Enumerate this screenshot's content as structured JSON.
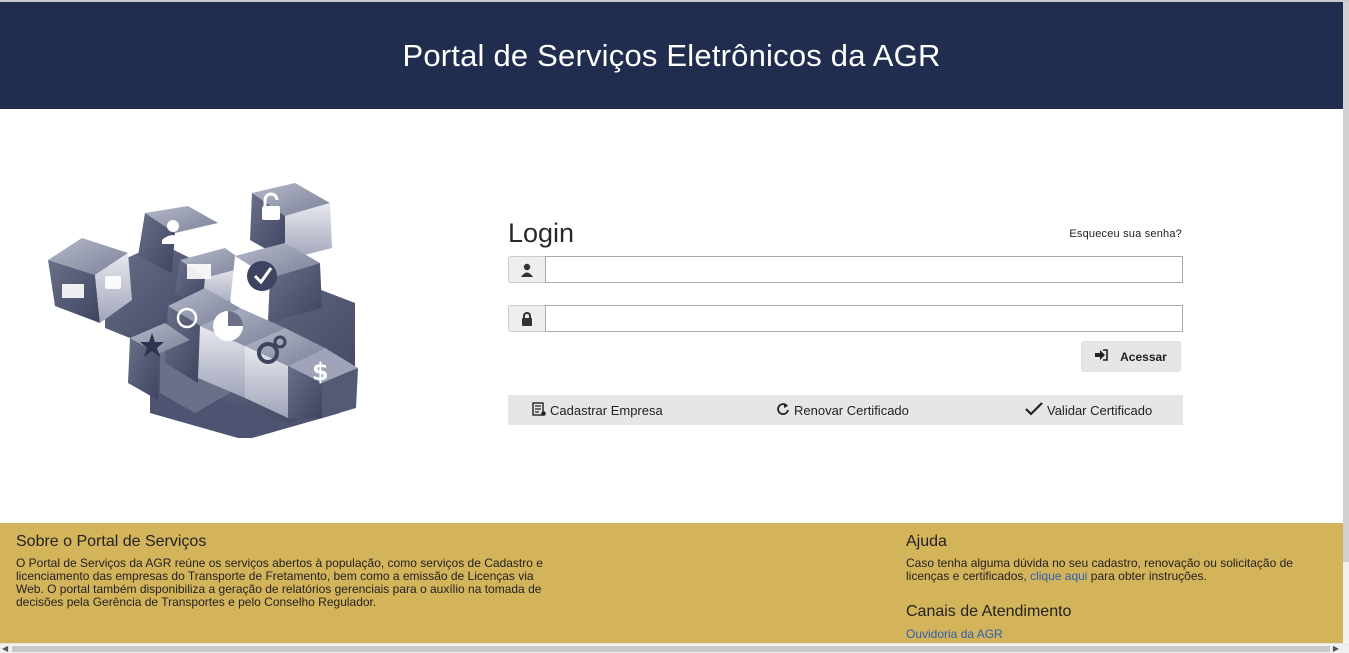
{
  "header": {
    "title": "Portal de Serviços Eletrônicos da AGR"
  },
  "login": {
    "title": "Login",
    "forgot_link": "Esqueceu sua senha?",
    "username_value": "",
    "password_value": "",
    "submit_label": "Acessar"
  },
  "actions": [
    {
      "label": "Cadastrar Empresa",
      "icon": "register-icon"
    },
    {
      "label": "Renovar Certificado",
      "icon": "refresh-icon"
    },
    {
      "label": "Validar Certificado",
      "icon": "check-icon"
    }
  ],
  "footer": {
    "about_title": "Sobre o Portal de Serviços",
    "about_text": "O Portal de Serviços da AGR reúne os serviços abertos à população, como serviços de Cadastro e licenciamento das empresas do Transporte de Fretamento, bem como a emissão de Licenças via Web. O portal também disponibiliza a geração de relatórios gerenciais para o auxílio na tomada de decisões pela Gerência de Transportes e pelo Conselho Regulador.",
    "help_title": "Ajuda",
    "help_text_before": "Caso tenha alguma dúvida no seu cadastro, renovação ou solicitação de licenças e certificados,",
    "help_link": "clique aqui",
    "help_text_after": "para obter instruções.",
    "channels_title": "Canais de Atendimento",
    "channels_link": "Ouvidoria da AGR"
  },
  "colors": {
    "header_bg": "#212d4f",
    "footer_bg": "#d4b45b",
    "link": "#2a5fb0"
  }
}
